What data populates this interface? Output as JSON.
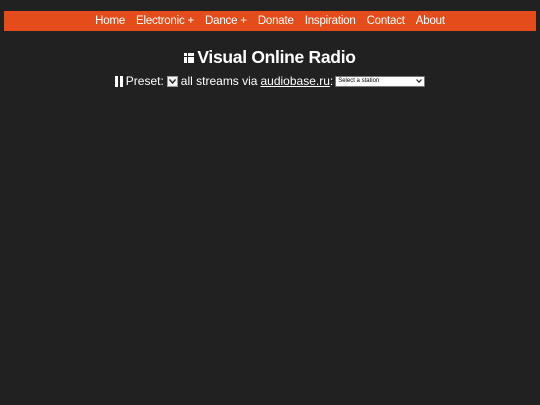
{
  "nav": {
    "items": [
      {
        "label": "Home"
      },
      {
        "label": "Electronic +"
      },
      {
        "label": "Dance +"
      },
      {
        "label": "Donate"
      },
      {
        "label": "Inspiration"
      },
      {
        "label": "Contact"
      },
      {
        "label": "About"
      }
    ],
    "background_color": "#e44d1b"
  },
  "header": {
    "title": "Visual Online Radio",
    "icon": "grid-icon"
  },
  "controls": {
    "play_icon": "pause-icon",
    "preset_label": "Preset:",
    "preset_dropdown_icon": "chevron-down-icon",
    "streams_text": "all streams via",
    "source_link": "audiobase.ru",
    "colon": ":",
    "station_select": {
      "selected": "Select a station"
    }
  },
  "colors": {
    "background": "#212121",
    "text": "#ffffff"
  }
}
